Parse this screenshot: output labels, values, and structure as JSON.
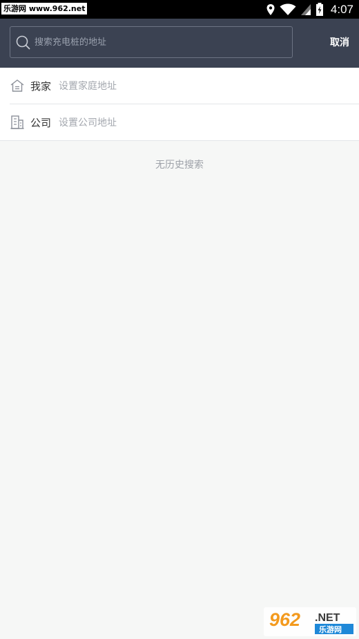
{
  "status_bar": {
    "watermark": "乐游网 www.962.net",
    "time": "4:07",
    "icons": [
      "location-icon",
      "wifi-icon",
      "signal-icon",
      "battery-icon"
    ]
  },
  "header": {
    "search_placeholder": "搜索充电桩的地址",
    "cancel_label": "取消"
  },
  "shortcuts": [
    {
      "icon": "home-icon",
      "label": "我家",
      "hint": "设置家庭地址"
    },
    {
      "icon": "building-icon",
      "label": "公司",
      "hint": "设置公司地址"
    }
  ],
  "history": {
    "empty_text": "无历史搜索"
  },
  "watermark_bottom": {
    "number": "962",
    "suffix": ".NET",
    "cn": "乐游网"
  },
  "colors": {
    "header_bg": "#3b4252",
    "page_bg": "#f6f7f6"
  }
}
